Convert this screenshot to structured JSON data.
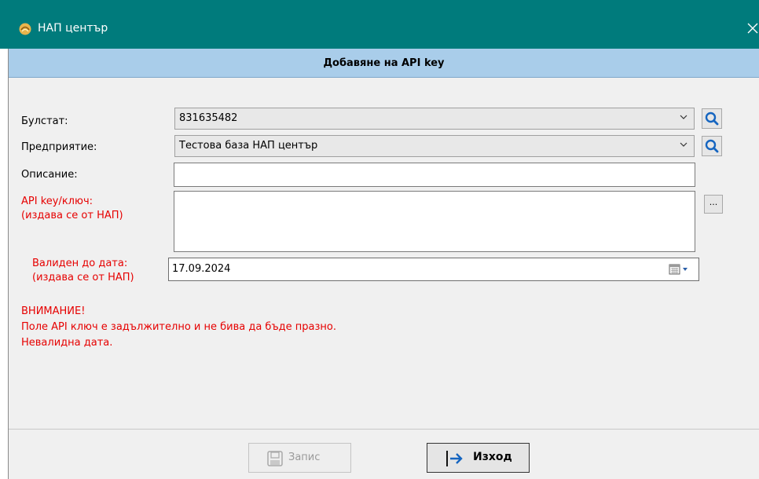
{
  "window": {
    "title": "НАП център",
    "close_label": "✕"
  },
  "dialog": {
    "heading": "Добавяне на API key"
  },
  "form": {
    "bulstat_label": "Булстат:",
    "bulstat_value": "831635482",
    "enterprise_label": "Предприятие:",
    "enterprise_value": "Тестова база НАП център",
    "description_label": "Описание:",
    "description_value": "",
    "apikey_label_line1": "API key/ключ:",
    "apikey_label_line2": "(издава се от НАП)",
    "apikey_value": "",
    "browse_label": "...",
    "valid_label_line1": "Валиден до дата:",
    "valid_label_line2": "(издава се от НАП)",
    "valid_value": "17.09.2024"
  },
  "warnings": [
    "ВНИМАНИЕ!",
    "Поле API ключ е задължително и не бива да бъде празно.",
    "Невалидна дата."
  ],
  "buttons": {
    "save_label": "Запис",
    "exit_label": "Изход"
  },
  "colors": {
    "titlebar": "#007b7c",
    "header_band": "#a9cdea",
    "error_text": "#e60000",
    "search_icon": "#1565c0"
  },
  "icons": {
    "title": "nap-logo-icon",
    "dropdown": "chevron-down-icon",
    "search": "search-icon",
    "calendar": "calendar-icon",
    "save": "save-icon",
    "exit": "exit-arrow-icon"
  }
}
